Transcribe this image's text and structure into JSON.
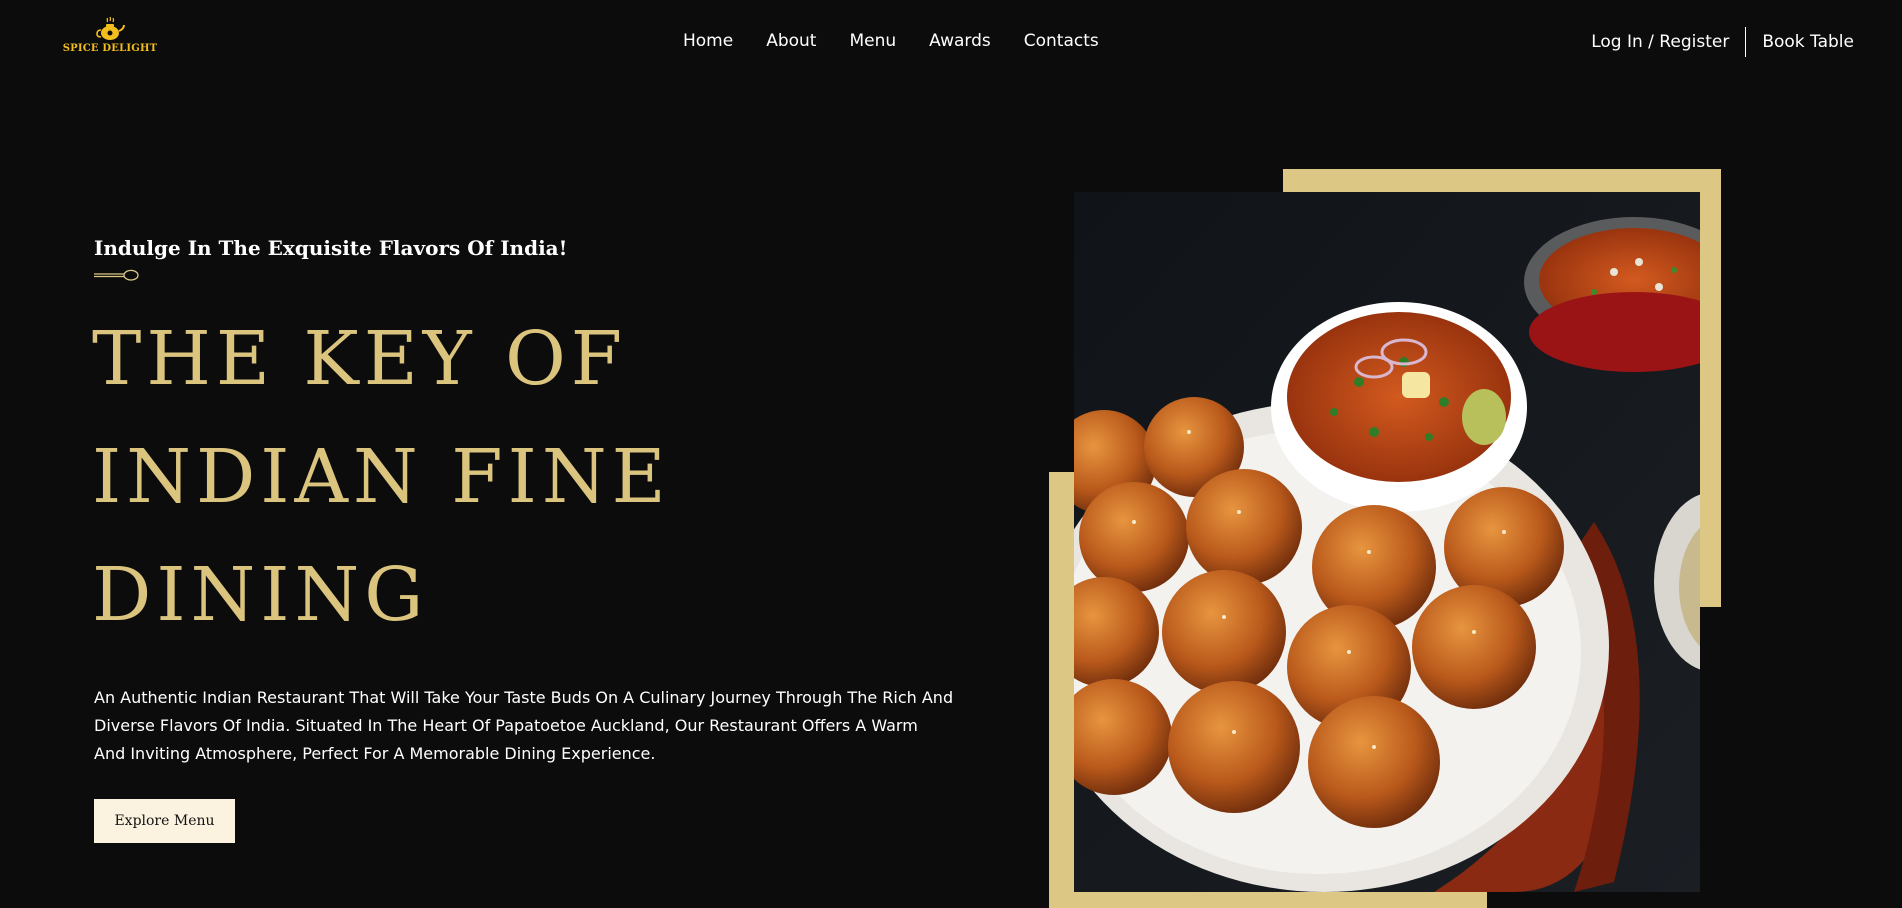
{
  "brand": {
    "name": "SPICE DELIGHT",
    "icon": "teapot-logo-icon",
    "color": "#f2bd1f"
  },
  "nav": {
    "items": [
      {
        "label": "Home"
      },
      {
        "label": "About"
      },
      {
        "label": "Menu"
      },
      {
        "label": "Awards"
      },
      {
        "label": "Contacts"
      }
    ]
  },
  "header_actions": {
    "login_label": "Log In / Register",
    "book_label": "Book Table"
  },
  "hero": {
    "tagline": "Indulge In The Exquisite Flavors Of India!",
    "divider_icon": "spoon-icon",
    "headline": [
      "THE KEY OF",
      "INDIAN FINE",
      "DINING"
    ],
    "description": "An Authentic Indian Restaurant That Will Take Your Taste Buds On A Culinary Journey Through The Rich And Diverse Flavors Of India. Situated In The Heart Of Papatoetoe Auckland, Our Restaurant Offers A Warm And Inviting Atmosphere, Perfect For A Memorable Dining Experience.",
    "cta_label": "Explore Menu",
    "image_subject": "pav bhaji with buttered buns on a white plate"
  },
  "colors": {
    "background": "#0c0c0c",
    "accent_gold": "#dbc47e",
    "frame_gold": "#dcc784",
    "button_bg": "#fbf3df",
    "text": "#ffffff"
  }
}
